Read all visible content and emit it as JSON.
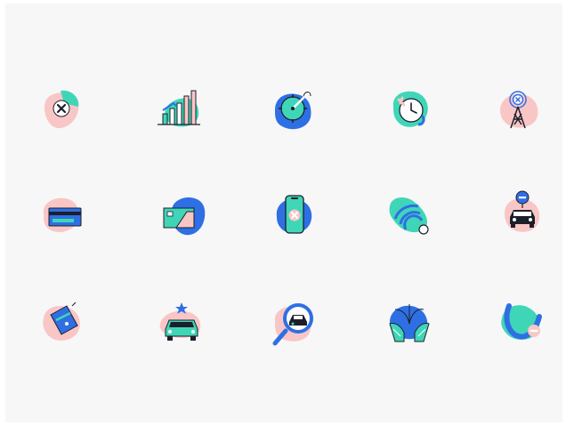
{
  "colors": {
    "background": "#f7f7f7",
    "pink": "#f9c6c6",
    "teal": "#3fd6b8",
    "blue": "#2f6fe4",
    "dark": "#1c1f2a",
    "white": "#ffffff"
  },
  "icons": [
    [
      "blob-x-icon",
      "bar-chart-growth-icon",
      "compass-target-icon",
      "clock-timer-icon",
      "signal-tower-icon"
    ],
    [
      "credit-card-icon",
      "photo-card-icon",
      "phone-cancel-icon",
      "wifi-leaf-icon",
      "car-cancel-pin-icon"
    ],
    [
      "tag-discount-icon",
      "taxi-star-icon",
      "search-car-icon",
      "hands-plant-icon",
      "wave-minus-icon"
    ]
  ]
}
